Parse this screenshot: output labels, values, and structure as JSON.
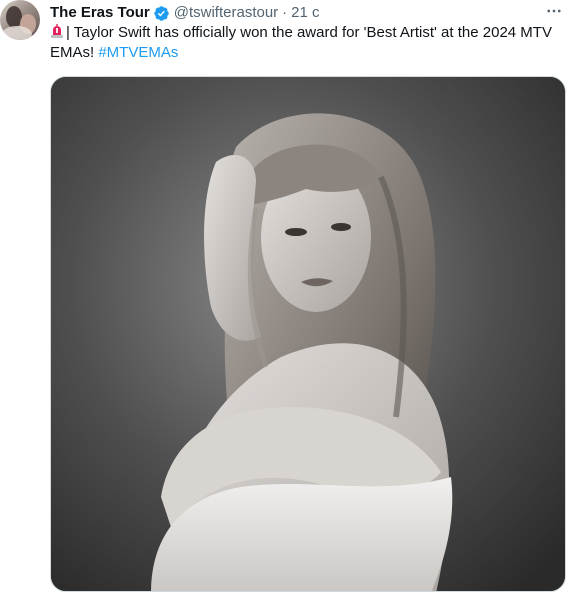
{
  "tweet": {
    "display_name": "The Eras Tour",
    "handle": "@tswifterastour",
    "separator": "·",
    "time": "21 с",
    "text_prefix": "| Taylor Swift has officially won the award for 'Best Artist' at the 2024 MTV EMAs! ",
    "hashtag": "#MTVEMAs",
    "verified_color": "#1d9bf0",
    "hashtag_color": "#1d9bf0",
    "siren_emoji_color": "#e0245e",
    "icons": {
      "avatar": "avatar-image",
      "verified": "verified-badge-icon",
      "more": "more-horizontal-icon",
      "siren": "siren-icon"
    }
  }
}
